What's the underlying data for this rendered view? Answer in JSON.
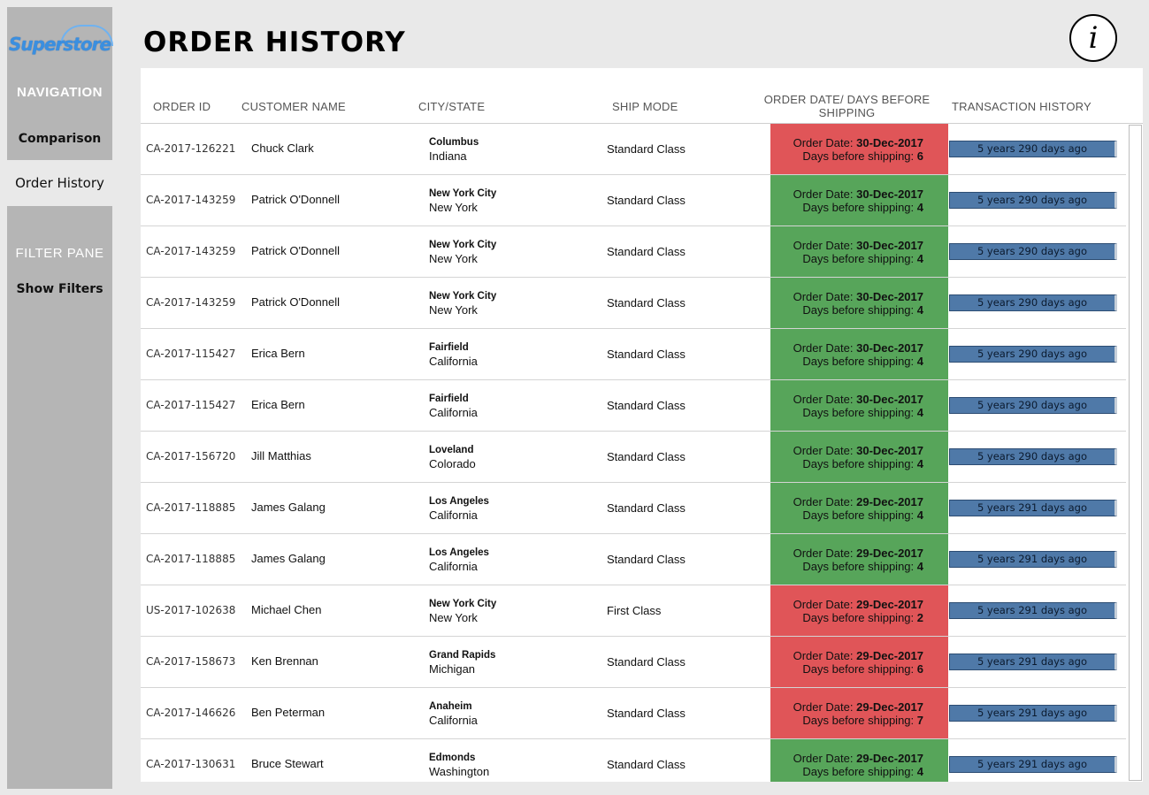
{
  "sidebar": {
    "logo_text": "Superstore",
    "navigation_title": "NAVIGATION",
    "comparison_link": "Comparison",
    "order_history_link": "Order History",
    "filter_pane_title": "FILTER PANE",
    "show_filters_link": "Show Filters"
  },
  "header": {
    "title": "ORDER HISTORY",
    "info_icon": "i"
  },
  "table": {
    "columns": {
      "order_id": "ORDER ID",
      "customer_name": "CUSTOMER NAME",
      "city_state": "CITY/STATE",
      "ship_mode": "SHIP MODE",
      "order_date_line1": "ORDER DATE/ DAYS BEFORE",
      "order_date_line2": "SHIPPING",
      "transaction_history": "TRANSACTION HISTORY"
    },
    "order_date_label": "Order Date: ",
    "days_label": "Days before shipping: ",
    "colors": {
      "green": "#57a55a",
      "red": "#e05558",
      "bar": "#4f79a8"
    },
    "rows": [
      {
        "id": "CA-2017-126221",
        "name": "Chuck Clark",
        "city": "Columbus",
        "state": "Indiana",
        "ship": "Standard Class",
        "date": "30-Dec-2017",
        "days": "6",
        "status": "red",
        "trans": "5 years 290 days ago"
      },
      {
        "id": "CA-2017-143259",
        "name": "Patrick O'Donnell",
        "city": "New York City",
        "state": "New York",
        "ship": "Standard Class",
        "date": "30-Dec-2017",
        "days": "4",
        "status": "green",
        "trans": "5 years 290 days ago"
      },
      {
        "id": "CA-2017-143259",
        "name": "Patrick O'Donnell",
        "city": "New York City",
        "state": "New York",
        "ship": "Standard Class",
        "date": "30-Dec-2017",
        "days": "4",
        "status": "green",
        "trans": "5 years 290 days ago"
      },
      {
        "id": "CA-2017-143259",
        "name": "Patrick O'Donnell",
        "city": "New York City",
        "state": "New York",
        "ship": "Standard Class",
        "date": "30-Dec-2017",
        "days": "4",
        "status": "green",
        "trans": "5 years 290 days ago"
      },
      {
        "id": "CA-2017-115427",
        "name": "Erica Bern",
        "city": "Fairfield",
        "state": "California",
        "ship": "Standard Class",
        "date": "30-Dec-2017",
        "days": "4",
        "status": "green",
        "trans": "5 years 290 days ago"
      },
      {
        "id": "CA-2017-115427",
        "name": "Erica Bern",
        "city": "Fairfield",
        "state": "California",
        "ship": "Standard Class",
        "date": "30-Dec-2017",
        "days": "4",
        "status": "green",
        "trans": "5 years 290 days ago"
      },
      {
        "id": "CA-2017-156720",
        "name": "Jill Matthias",
        "city": "Loveland",
        "state": "Colorado",
        "ship": "Standard Class",
        "date": "30-Dec-2017",
        "days": "4",
        "status": "green",
        "trans": "5 years 290 days ago"
      },
      {
        "id": "CA-2017-118885",
        "name": "James Galang",
        "city": "Los Angeles",
        "state": "California",
        "ship": "Standard Class",
        "date": "29-Dec-2017",
        "days": "4",
        "status": "green",
        "trans": "5 years 291 days ago"
      },
      {
        "id": "CA-2017-118885",
        "name": "James Galang",
        "city": "Los Angeles",
        "state": "California",
        "ship": "Standard Class",
        "date": "29-Dec-2017",
        "days": "4",
        "status": "green",
        "trans": "5 years 291 days ago"
      },
      {
        "id": "US-2017-102638",
        "name": "Michael Chen",
        "city": "New York City",
        "state": "New York",
        "ship": "First Class",
        "date": "29-Dec-2017",
        "days": "2",
        "status": "red",
        "trans": "5 years 291 days ago"
      },
      {
        "id": "CA-2017-158673",
        "name": "Ken Brennan",
        "city": "Grand Rapids",
        "state": "Michigan",
        "ship": "Standard Class",
        "date": "29-Dec-2017",
        "days": "6",
        "status": "red",
        "trans": "5 years 291 days ago"
      },
      {
        "id": "CA-2017-146626",
        "name": "Ben Peterman",
        "city": "Anaheim",
        "state": "California",
        "ship": "Standard Class",
        "date": "29-Dec-2017",
        "days": "7",
        "status": "red",
        "trans": "5 years 291 days ago"
      },
      {
        "id": "CA-2017-130631",
        "name": "Bruce Stewart",
        "city": "Edmonds",
        "state": "Washington",
        "ship": "Standard Class",
        "date": "29-Dec-2017",
        "days": "4",
        "status": "green",
        "trans": "5 years 291 days ago"
      }
    ]
  }
}
